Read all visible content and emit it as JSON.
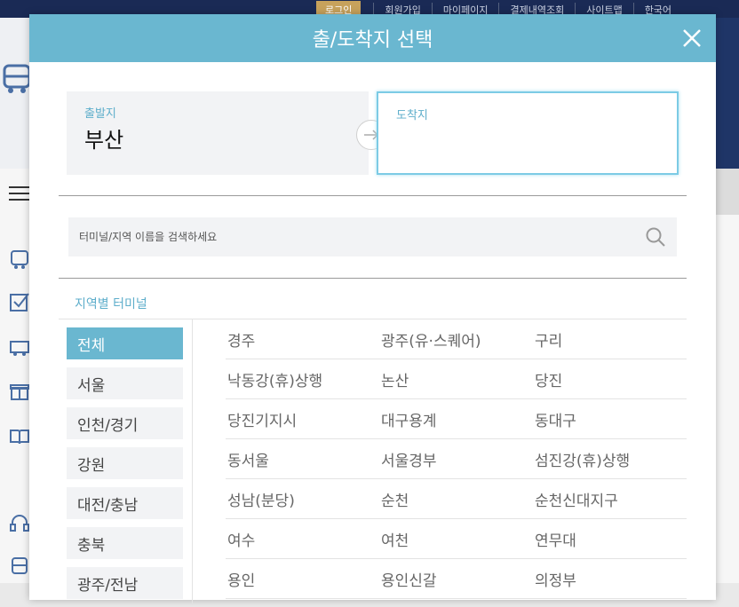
{
  "background": {
    "top_nav": {
      "login": "로그인",
      "links": [
        "회원가입",
        "마이페이지",
        "결제내역조회",
        "사이트맵",
        "한국어"
      ]
    }
  },
  "modal": {
    "title": "출/도착지 선택",
    "depart": {
      "label": "출발지",
      "value": "부산"
    },
    "arrive": {
      "label": "도착지",
      "value": ""
    },
    "search": {
      "placeholder": "터미널/지역 이름을 검색하세요",
      "value": ""
    },
    "section_title": "지역별 터미널",
    "regions": [
      "전체",
      "서울",
      "인천/경기",
      "강원",
      "대전/충남",
      "충북",
      "광주/전남"
    ],
    "active_region": "전체",
    "terminals": [
      [
        "경주",
        "광주(유·스퀘어)",
        "구리"
      ],
      [
        "낙동강(휴)상행",
        "논산",
        "당진"
      ],
      [
        "당진기지시",
        "대구용계",
        "동대구"
      ],
      [
        "동서울",
        "서울경부",
        "섬진강(휴)상행"
      ],
      [
        "성남(분당)",
        "순천",
        "순천신대지구"
      ],
      [
        "여수",
        "여천",
        "연무대"
      ],
      [
        "용인",
        "용인신갈",
        "의정부"
      ]
    ]
  }
}
